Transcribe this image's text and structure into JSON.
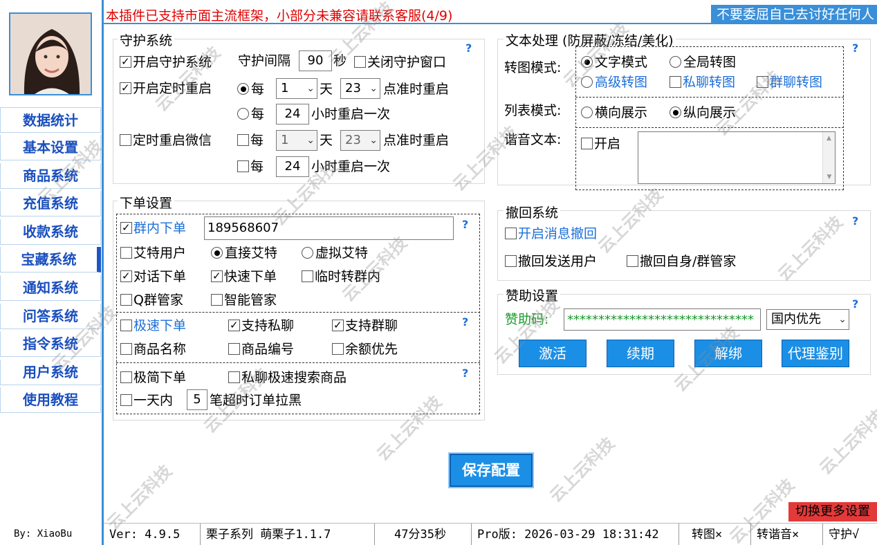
{
  "header": {
    "notice": "本插件已支持市面主流框架，小部分未兼容请联系客服(4/9)",
    "motto": "不要委屈自己去讨好任何人"
  },
  "sidebar": {
    "items": [
      "数据统计",
      "基本设置",
      "商品系统",
      "充值系统",
      "收款系统",
      "宝藏系统",
      "通知系统",
      "问答系统",
      "指令系统",
      "用户系统",
      "使用教程"
    ],
    "byline": "By: XiaoBu"
  },
  "guard": {
    "title": "守护系统",
    "enable": "开启守护系统",
    "interval_label": "守护间隔",
    "interval": "90",
    "sec": "秒",
    "close_window": "关闭守护窗口",
    "timed_restart": "开启定时重启",
    "every": "每",
    "day": "天",
    "restart_day_val": "1",
    "restart_hour_val": "23",
    "at_hour": "点准时重启",
    "hours_val": "24",
    "hours_restart": "小时重启一次",
    "wechat_restart": "定时重启微信",
    "wx_day_val": "1",
    "wx_hour_val": "23",
    "wx_hours_val": "24"
  },
  "order": {
    "title": "下单设置",
    "group_order": "群内下单",
    "group_id": "189568607",
    "at_user": "艾特用户",
    "direct_at": "直接艾特",
    "virtual_at": "虚拟艾特",
    "dialog_order": "对话下单",
    "fast_order": "快速下单",
    "temp_to_group": "临时转群内",
    "q_admin": "Q群管家",
    "smart_admin": "智能管家",
    "speed_order": "极速下单",
    "support_private": "支持私聊",
    "support_group": "支持群聊",
    "product_name": "商品名称",
    "product_code": "商品编号",
    "balance_first": "余额优先",
    "simple_order": "极简下单",
    "private_search": "私聊极速搜索商品",
    "one_day": "一天内",
    "timeout_count": "5",
    "timeout_blacklist": "笔超时订单拉黑"
  },
  "text": {
    "title": "文本处理 (防屏蔽/冻结/美化)",
    "image_mode": "转图模式:",
    "text_mode": "文字模式",
    "global_image": "全局转图",
    "advanced_image": "高级转图",
    "private_image": "私聊转图",
    "group_image": "群聊转图",
    "list_mode": "列表模式:",
    "horizontal": "横向展示",
    "vertical": "纵向展示",
    "homophone": "谐音文本:",
    "enable": "开启"
  },
  "recall": {
    "title": "撤回系统",
    "enable_recall": "开启消息撤回",
    "recall_sent": "撤回发送用户",
    "recall_self": "撤回自身/群管家"
  },
  "sponsor": {
    "title": "赞助设置",
    "code_label": "赞助码:",
    "code": "******************************",
    "region": "国内优先",
    "activate": "激活",
    "renew": "续期",
    "unbind": "解绑",
    "agent_check": "代理鉴别"
  },
  "help": "?",
  "save": "保存配置",
  "switch_more": "切换更多设置",
  "status": {
    "ver": "Ver: 4.9.5",
    "series": "栗子系列 萌栗子1.1.7",
    "time": "47分35秒",
    "pro": "Pro版: 2026-03-29 18:31:42",
    "img": "转图×",
    "homo": "转谐音×",
    "guard": "守护√"
  },
  "watermark": "云上云科技"
}
